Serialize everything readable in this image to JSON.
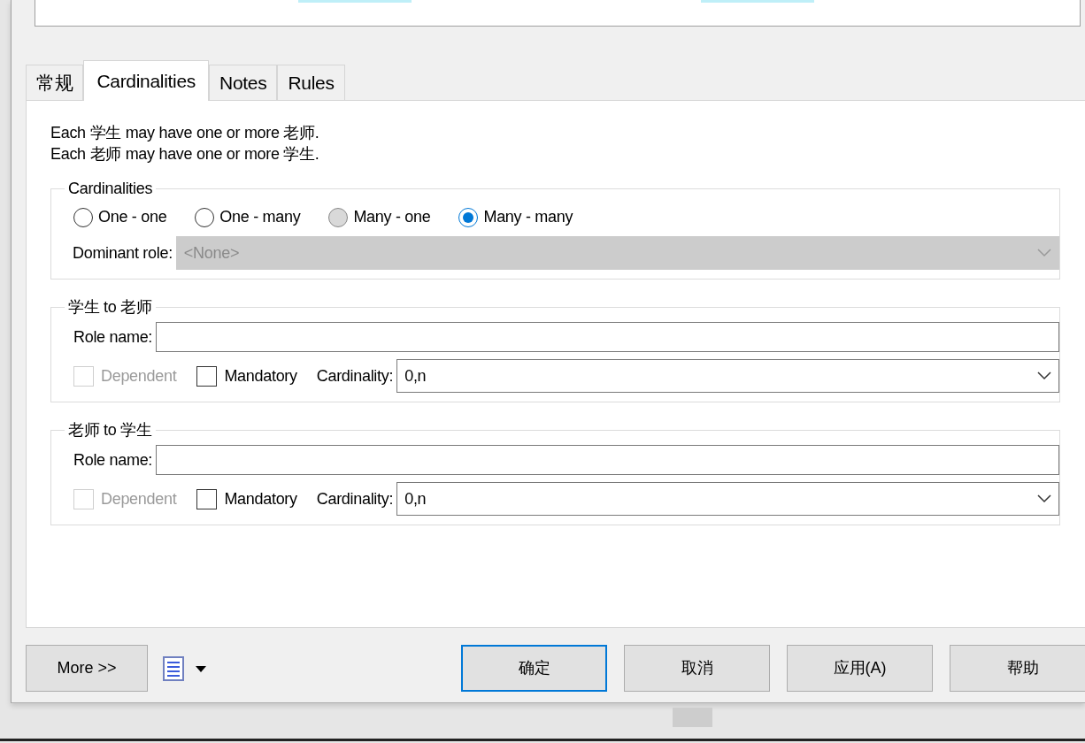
{
  "tabs": [
    {
      "label": "常规",
      "selected": false
    },
    {
      "label": "Cardinalities",
      "selected": true
    },
    {
      "label": "Notes",
      "selected": false
    },
    {
      "label": "Rules",
      "selected": false
    }
  ],
  "description": [
    "Each 学生 may have one or more 老师.",
    "Each 老师 may have one or more 学生."
  ],
  "cardinalities": {
    "title": "Cardinalities",
    "options": [
      {
        "label": "One - one",
        "selected": false,
        "pressed": false
      },
      {
        "label": "One - many",
        "selected": false,
        "pressed": false
      },
      {
        "label": "Many - one",
        "selected": false,
        "pressed": true
      },
      {
        "label": "Many - many",
        "selected": true,
        "pressed": false
      }
    ],
    "dominant_role": {
      "label": "Dominant role:",
      "value": "<None>",
      "disabled": true
    }
  },
  "roles": [
    {
      "title": "学生 to 老师",
      "role_name_label": "Role name:",
      "dependent": {
        "label": "Dependent",
        "checked": false,
        "disabled": true
      },
      "mandatory": {
        "label": "Mandatory",
        "checked": false,
        "disabled": false
      },
      "cardinality_label": "Cardinality:",
      "cardinality": "0,n"
    },
    {
      "title": "老师 to 学生",
      "role_name_label": "Role name:",
      "dependent": {
        "label": "Dependent",
        "checked": false,
        "disabled": true
      },
      "mandatory": {
        "label": "Mandatory",
        "checked": false,
        "disabled": false
      },
      "cardinality_label": "Cardinality:",
      "cardinality": "0,n"
    }
  ],
  "footer": {
    "more": "More >>",
    "buttons": [
      {
        "label": "确定",
        "default": true
      },
      {
        "label": "取消",
        "default": false
      },
      {
        "label": "应用(A)",
        "default": false
      },
      {
        "label": "帮助",
        "default": false
      }
    ]
  }
}
